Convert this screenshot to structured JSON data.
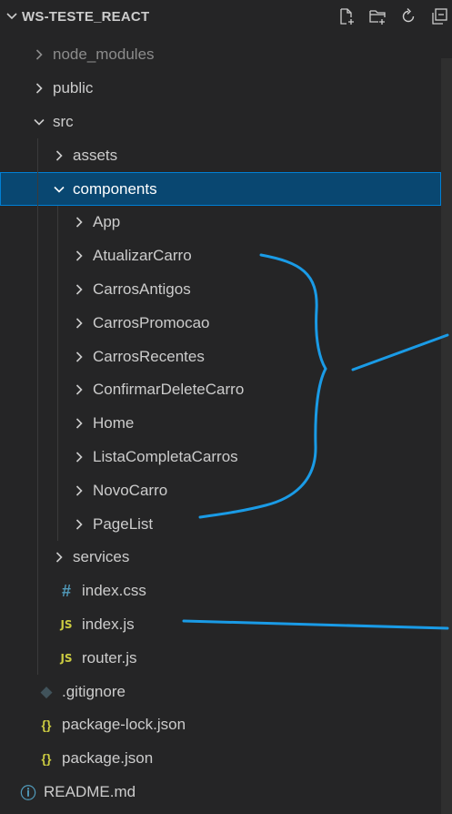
{
  "explorer": {
    "title": "WS-TESTE_REACT",
    "actions": [
      {
        "name": "new-file-icon"
      },
      {
        "name": "new-folder-icon"
      },
      {
        "name": "refresh-icon"
      },
      {
        "name": "collapse-all-icon"
      }
    ]
  },
  "tree": [
    {
      "label": "node_modules",
      "type": "folder",
      "open": false,
      "depth": 1,
      "dim": true
    },
    {
      "label": "public",
      "type": "folder",
      "open": false,
      "depth": 1
    },
    {
      "label": "src",
      "type": "folder",
      "open": true,
      "depth": 1
    },
    {
      "label": "assets",
      "type": "folder",
      "open": false,
      "depth": 2
    },
    {
      "label": "components",
      "type": "folder",
      "open": true,
      "depth": 2,
      "selected": true
    },
    {
      "label": "App",
      "type": "folder",
      "open": false,
      "depth": 3
    },
    {
      "label": "AtualizarCarro",
      "type": "folder",
      "open": false,
      "depth": 3
    },
    {
      "label": "CarrosAntigos",
      "type": "folder",
      "open": false,
      "depth": 3
    },
    {
      "label": "CarrosPromocao",
      "type": "folder",
      "open": false,
      "depth": 3
    },
    {
      "label": "CarrosRecentes",
      "type": "folder",
      "open": false,
      "depth": 3
    },
    {
      "label": "ConfirmarDeleteCarro",
      "type": "folder",
      "open": false,
      "depth": 3
    },
    {
      "label": "Home",
      "type": "folder",
      "open": false,
      "depth": 3
    },
    {
      "label": "ListaCompletaCarros",
      "type": "folder",
      "open": false,
      "depth": 3
    },
    {
      "label": "NovoCarro",
      "type": "folder",
      "open": false,
      "depth": 3
    },
    {
      "label": "PageList",
      "type": "folder",
      "open": false,
      "depth": 3
    },
    {
      "label": "services",
      "type": "folder",
      "open": false,
      "depth": 2
    },
    {
      "label": "index.css",
      "type": "file",
      "icon": "css",
      "icon_text": "#",
      "depth": 2
    },
    {
      "label": "index.js",
      "type": "file",
      "icon": "js",
      "icon_text": "JS",
      "depth": 2
    },
    {
      "label": "router.js",
      "type": "file",
      "icon": "js",
      "icon_text": "JS",
      "depth": 2
    },
    {
      "label": ".gitignore",
      "type": "file",
      "icon": "git",
      "icon_text": "◆",
      "depth": 1
    },
    {
      "label": "package-lock.json",
      "type": "file",
      "icon": "json",
      "icon_text": "{}",
      "depth": 1
    },
    {
      "label": "package.json",
      "type": "file",
      "icon": "json",
      "icon_text": "{}",
      "depth": 1
    },
    {
      "label": "README.md",
      "type": "file",
      "icon": "info",
      "icon_text": "ⓘ",
      "depth": 0
    }
  ],
  "colors": {
    "background": "#252526",
    "selection": "#094771",
    "annotation": "#1a9be6"
  }
}
